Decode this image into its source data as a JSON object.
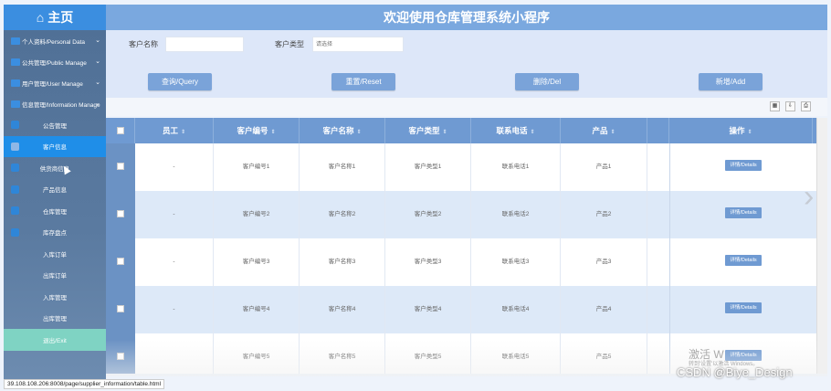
{
  "sidebar": {
    "home_label": "主页",
    "groups": [
      {
        "label": "个人资料/Personal Data"
      },
      {
        "label": "公共管理/Public Manage"
      },
      {
        "label": "用户管理/User Manage"
      },
      {
        "label": "信息管理/Information Manage"
      }
    ],
    "items": [
      {
        "label": "公告管理"
      },
      {
        "label": "客户信息"
      },
      {
        "label": "供货商信息"
      },
      {
        "label": "产品信息"
      },
      {
        "label": "仓库管理"
      },
      {
        "label": "库存盘点"
      },
      {
        "label": "入库订单"
      },
      {
        "label": "出库订单"
      },
      {
        "label": "入库管理"
      },
      {
        "label": "出库管理"
      }
    ],
    "exit_label": "退出/Exit"
  },
  "header": {
    "title": "欢迎使用仓库管理系统小程序"
  },
  "search": {
    "name_label": "客户名称",
    "name_value": "",
    "type_label": "客户类型",
    "type_placeholder": "请选择"
  },
  "buttons": {
    "query": "查询/Query",
    "reset": "重置/Reset",
    "delete": "删除/Del",
    "add": "新增/Add"
  },
  "table": {
    "columns": [
      "员工",
      "客户编号",
      "客户名称",
      "客户类型",
      "联系电话",
      "产品",
      "",
      "操作"
    ],
    "detail_label": "详情/Details",
    "rows": [
      [
        "-",
        "客户编号1",
        "客户名称1",
        "客户类型1",
        "联系电话1",
        "产品1"
      ],
      [
        "-",
        "客户编号2",
        "客户名称2",
        "客户类型2",
        "联系电话2",
        "产品2"
      ],
      [
        "-",
        "客户编号3",
        "客户名称3",
        "客户类型3",
        "联系电话3",
        "产品3"
      ],
      [
        "-",
        "客户编号4",
        "客户名称4",
        "客户类型4",
        "联系电话4",
        "产品4"
      ],
      [
        "",
        "客户编号5",
        "客户名称5",
        "客户类型5",
        "联系电话5",
        "产品5"
      ]
    ]
  },
  "status_url": "39.108.108.206:8008/page/supplier_information/table.html",
  "watermark": "CSDN @Biye_Design",
  "activate_text": "激活 W",
  "activate_sub": "转到'设置'以激活 Windows。",
  "colors": {
    "sidebar": "#5a7aa0",
    "header": "#7aa8df",
    "active": "#1f8ee8",
    "exit": "#7fd3c3",
    "table_head": "#6f9ad2"
  },
  "icons": [
    "home-icon",
    "chevron-down-icon",
    "chevron-right-icon"
  ]
}
